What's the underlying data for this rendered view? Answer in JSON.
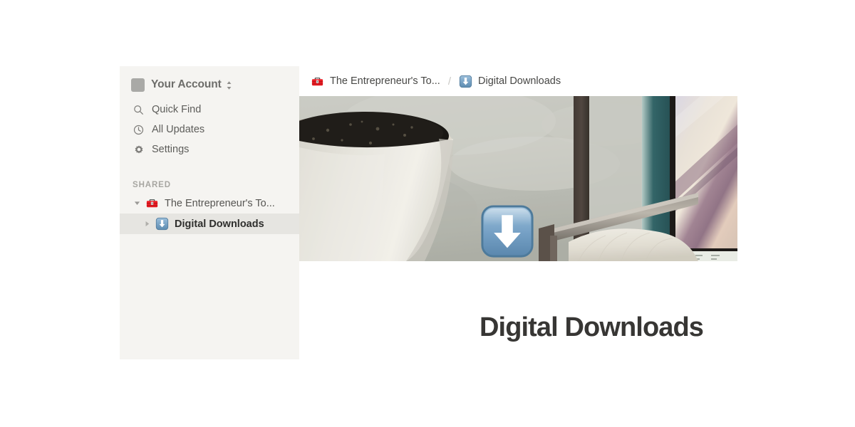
{
  "sidebar": {
    "account": {
      "name": "Your Account",
      "avatar_icon": "account-avatar-square",
      "switcher_icon": "up-down-chevron-icon"
    },
    "nav": [
      {
        "label": "Quick Find",
        "icon": "search-icon"
      },
      {
        "label": "All Updates",
        "icon": "clock-icon"
      },
      {
        "label": "Settings",
        "icon": "gear-icon"
      }
    ],
    "sections": [
      {
        "title": "SHARED",
        "items": [
          {
            "label": "The Entrepreneur's To...",
            "icon": "toolbox-emoji",
            "twisty": "triangle-down-icon",
            "expanded": true,
            "selected": false,
            "indent": false
          },
          {
            "label": "Digital Downloads",
            "icon": "download-emoji",
            "twisty": "triangle-right-icon",
            "expanded": false,
            "selected": true,
            "indent": true
          }
        ]
      }
    ]
  },
  "breadcrumb": {
    "separator": "/",
    "crumbs": [
      {
        "label": "The Entrepreneur's To...",
        "icon": "toolbox-emoji"
      },
      {
        "label": "Digital Downloads",
        "icon": "download-emoji"
      }
    ]
  },
  "page": {
    "cover_alt": "interior-photo-planter-chair-artwork",
    "icon": "download-emoji",
    "title": "Digital Downloads"
  },
  "colors": {
    "sidebar_bg": "#f5f4f1",
    "sidebar_selected": "#e6e5e1",
    "page_bg": "#ffffff",
    "title_text": "#373634",
    "muted_text": "#a7a6a1",
    "toolbox_red": "#ec1c24",
    "download_blue": "#6f9ec4"
  }
}
